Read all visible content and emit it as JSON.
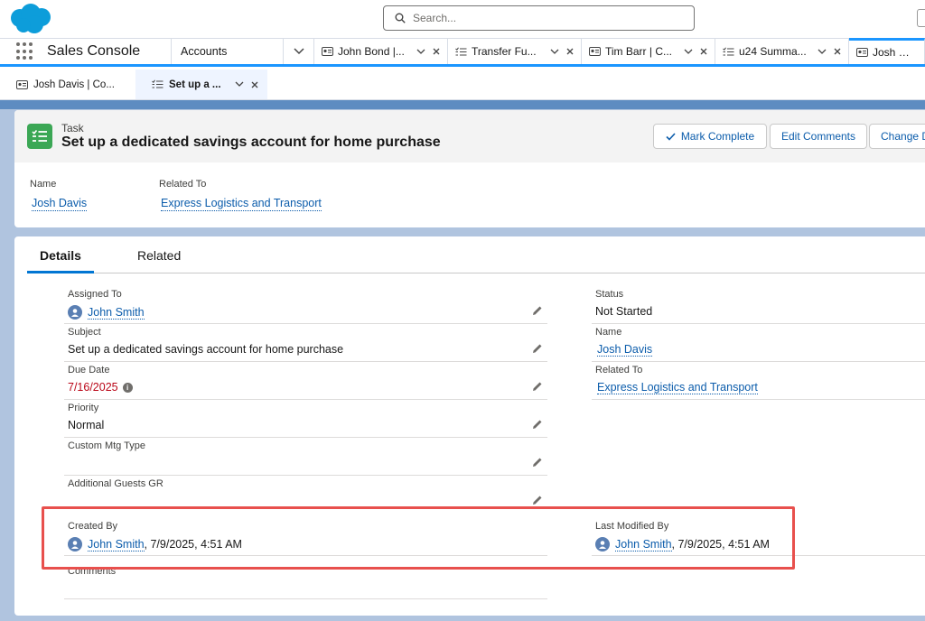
{
  "search": {
    "placeholder": "Search..."
  },
  "nav": {
    "app_name": "Sales Console",
    "object_tab": "Accounts",
    "tabs": [
      {
        "label": "John Bond |..."
      },
      {
        "label": "Transfer Fu..."
      },
      {
        "label": "Tim Barr | C..."
      },
      {
        "label": "u24 Summa..."
      },
      {
        "label": "Josh Davis"
      }
    ]
  },
  "subtabs": [
    {
      "label": "Josh Davis | Co..."
    },
    {
      "label": "Set up a ..."
    }
  ],
  "header": {
    "object_label": "Task",
    "title": "Set up a dedicated savings account for home purchase",
    "buttons": {
      "mark_complete": "Mark Complete",
      "edit_comments": "Edit Comments",
      "change": "Change D"
    },
    "highlights": {
      "name_label": "Name",
      "name_value": "Josh Davis",
      "related_label": "Related To",
      "related_value": "Express Logistics and Transport"
    }
  },
  "details": {
    "tabs": {
      "details": "Details",
      "related": "Related"
    },
    "left": [
      {
        "label": "Assigned To",
        "value": "John Smith"
      },
      {
        "label": "Subject",
        "value": "Set up a dedicated savings account for home purchase"
      },
      {
        "label": "Due Date",
        "value": "7/16/2025"
      },
      {
        "label": "Priority",
        "value": "Normal"
      },
      {
        "label": "Custom Mtg Type",
        "value": ""
      },
      {
        "label": "Additional Guests GR",
        "value": ""
      }
    ],
    "right": [
      {
        "label": "Status",
        "value": "Not Started"
      },
      {
        "label": "Name",
        "value": "Josh Davis"
      },
      {
        "label": "Related To",
        "value": "Express Logistics and Transport"
      }
    ],
    "created_by": {
      "label": "Created By",
      "user": "John Smith",
      "stamp": ", 7/9/2025, 4:51 AM"
    },
    "modified_by": {
      "label": "Last Modified By",
      "user": "John Smith",
      "stamp": ", 7/9/2025, 4:51 AM"
    },
    "comments_label": "Comments"
  },
  "colors": {
    "brand": "#0176d3",
    "link": "#0b5cab",
    "task_green": "#3ba755",
    "highlight_red": "#e8504d",
    "overdue_red": "#ba0517"
  }
}
